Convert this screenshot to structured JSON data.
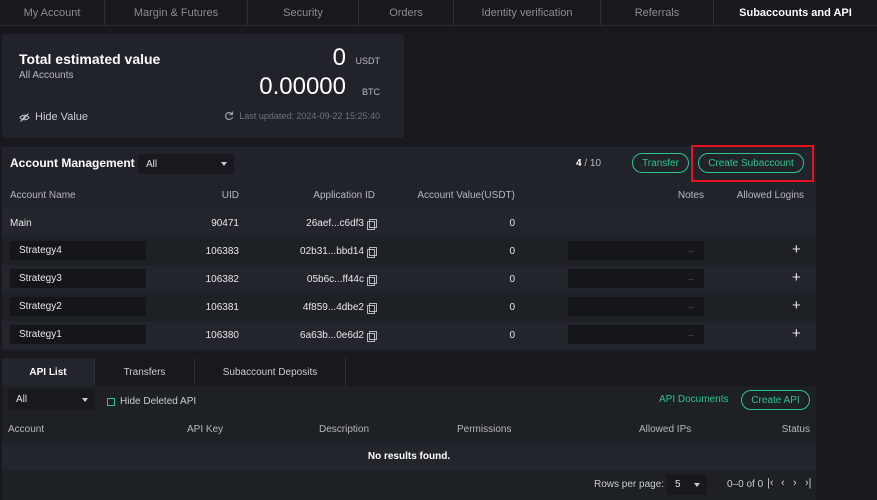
{
  "nav": {
    "tabs": [
      {
        "label": "My Account"
      },
      {
        "label": "Margin & Futures"
      },
      {
        "label": "Security"
      },
      {
        "label": "Orders"
      },
      {
        "label": "Identity verification"
      },
      {
        "label": "Referrals"
      },
      {
        "label": "Subaccounts and API"
      }
    ]
  },
  "summary": {
    "title": "Total estimated value",
    "subtitle": "All Accounts",
    "usdt_value": "0",
    "usdt_unit": "USDT",
    "btc_value": "0.00000",
    "btc_unit": "BTC",
    "hide_label": "Hide Value",
    "updated": "Last updated: 2024-09-22 15:25:40"
  },
  "accounts": {
    "title": "Account Management",
    "filter": "All",
    "count_current": "4",
    "count_total": "/ 10",
    "transfer_label": "Transfer",
    "create_label": "Create Subaccount",
    "columns": {
      "name": "Account Name",
      "uid": "UID",
      "app_id": "Application ID",
      "value": "Account Value(USDT)",
      "notes": "Notes",
      "logins": "Allowed Logins"
    },
    "main": {
      "name": "Main",
      "uid": "90471",
      "app_id": "26aef...c6df3",
      "value": "0"
    },
    "subs": [
      {
        "name": "Strategy4",
        "uid": "106383",
        "app_id": "02b31...bbd14",
        "value": "0",
        "notes": "--",
        "add": "+"
      },
      {
        "name": "Strategy3",
        "uid": "106382",
        "app_id": "05b6c...ff44c",
        "value": "0",
        "notes": "--",
        "add": "+"
      },
      {
        "name": "Strategy2",
        "uid": "106381",
        "app_id": "4f859...4dbe2",
        "value": "0",
        "notes": "--",
        "add": "+"
      },
      {
        "name": "Strategy1",
        "uid": "106380",
        "app_id": "6a63b...0e6d2",
        "value": "0",
        "notes": "--",
        "add": "+"
      }
    ]
  },
  "api": {
    "tabs": [
      {
        "label": "API List"
      },
      {
        "label": "Transfers"
      },
      {
        "label": "Subaccount Deposits"
      }
    ],
    "filter": "All",
    "hide_deleted": "Hide Deleted API",
    "docs_label": "API Documents",
    "create_label": "Create API",
    "columns": {
      "account": "Account",
      "key": "API Key",
      "description": "Description",
      "permissions": "Permissions",
      "ips": "Allowed IPs",
      "status": "Status"
    },
    "empty": "No results found.",
    "rows_per_page_label": "Rows per page:",
    "rows_per_page": "5",
    "range": "0–0 of 0"
  },
  "colors": {
    "accent": "#2fc38a",
    "highlight": "#e8121e"
  }
}
